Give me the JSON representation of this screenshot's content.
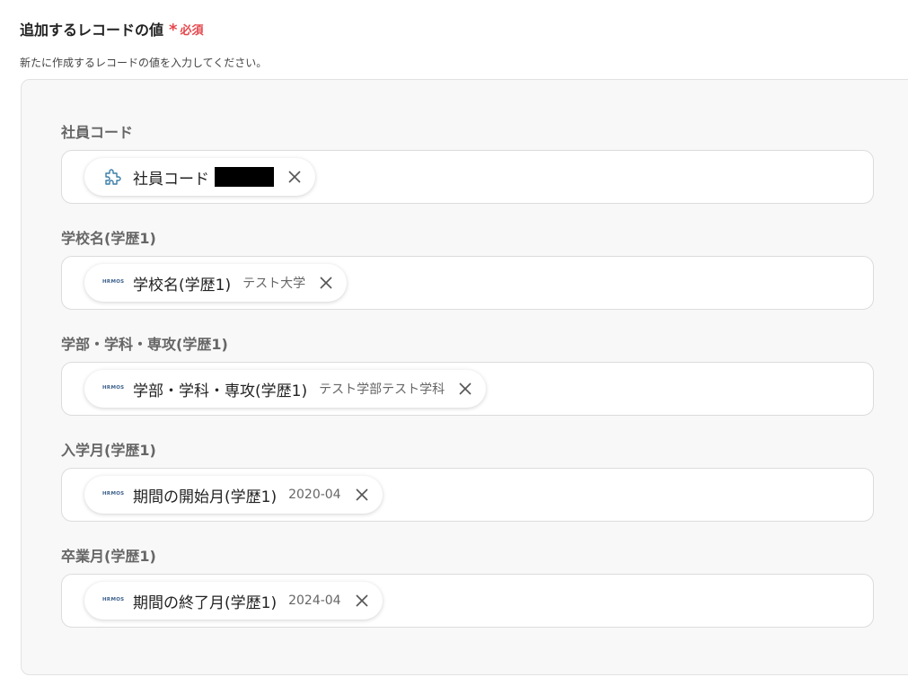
{
  "section": {
    "title": "追加するレコードの値",
    "required_mark": "*",
    "required_text": "必須",
    "description": "新たに作成するレコードの値を入力してください。"
  },
  "fields": [
    {
      "label": "社員コード",
      "chip": {
        "icon": "puzzle-icon",
        "label": "社員コード",
        "value": "",
        "redacted": true
      }
    },
    {
      "label": "学校名(学歴1)",
      "chip": {
        "icon": "hrmos-logo",
        "label": "学校名(学歴1)",
        "value": "テスト大学"
      }
    },
    {
      "label": "学部・学科・専攻(学歴1)",
      "chip": {
        "icon": "hrmos-logo",
        "label": "学部・学科・専攻(学歴1)",
        "value": "テスト学部テスト学科"
      }
    },
    {
      "label": "入学月(学歴1)",
      "chip": {
        "icon": "hrmos-logo",
        "label": "期間の開始月(学歴1)",
        "value": "2020-04"
      }
    },
    {
      "label": "卒業月(学歴1)",
      "chip": {
        "icon": "hrmos-logo",
        "label": "期間の終了月(学歴1)",
        "value": "2024-04"
      }
    }
  ],
  "hrmos_logo_text": "HRMOS",
  "colors": {
    "required": "#e5484d",
    "panel_bg": "#f8f8f8",
    "logo": "#3b5f8a"
  }
}
